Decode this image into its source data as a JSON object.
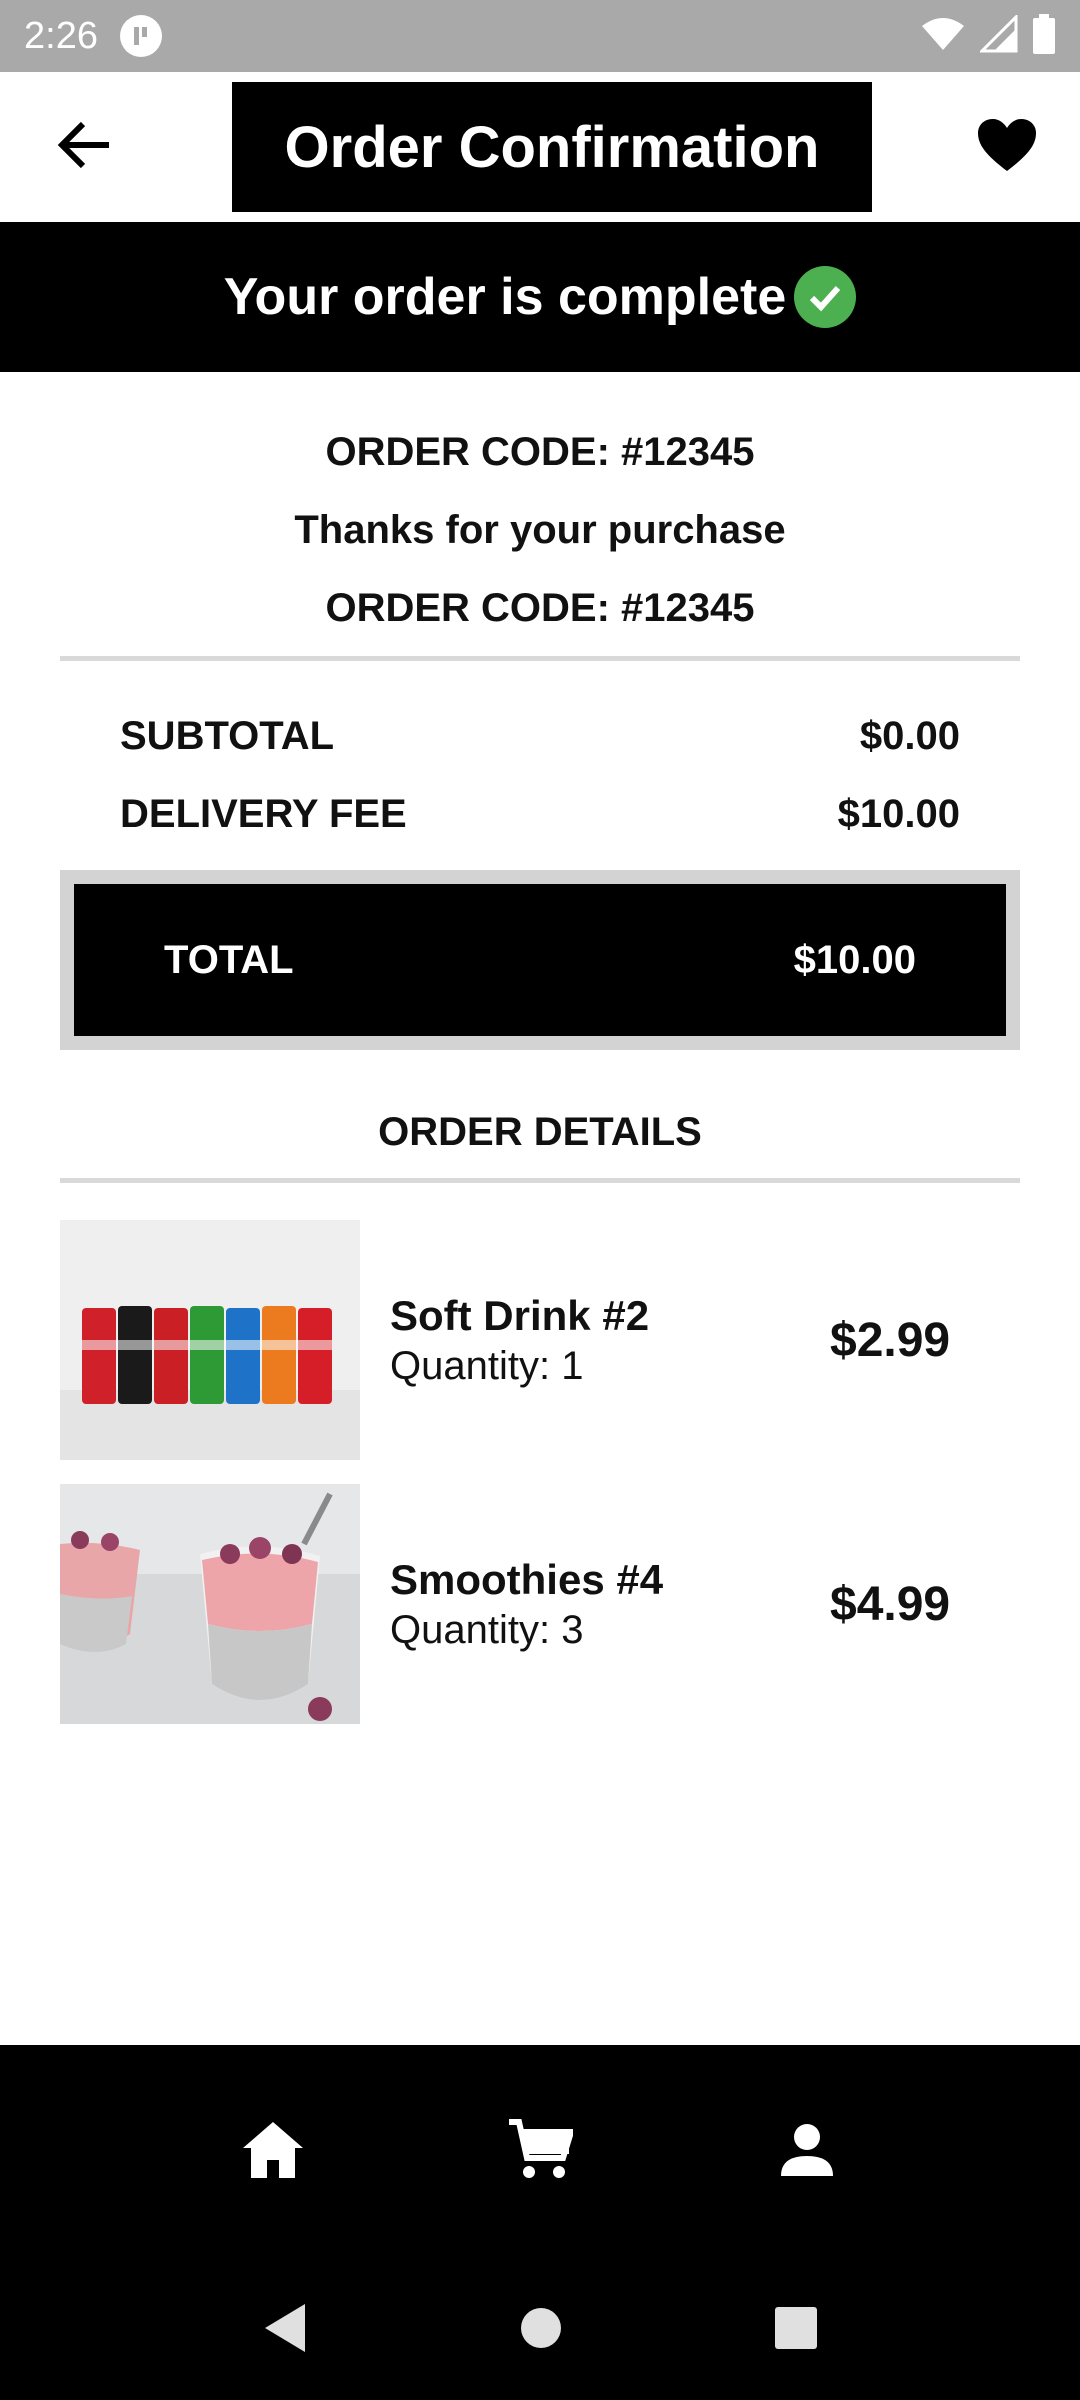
{
  "status_bar": {
    "time": "2:26"
  },
  "header": {
    "title": "Order Confirmation",
    "back_icon": "arrow-left-icon",
    "favorite_icon": "heart-icon"
  },
  "banner": {
    "text": "Your order is complete",
    "icon": "check-circle-icon",
    "icon_color": "#4caf50"
  },
  "order": {
    "code_line_1": "ORDER CODE: #12345",
    "thanks": "Thanks for your purchase",
    "code_line_2": "ORDER CODE: #12345"
  },
  "summary": {
    "subtotal_label": "SUBTOTAL",
    "subtotal_value": "$0.00",
    "delivery_label": "DELIVERY FEE",
    "delivery_value": "$10.00",
    "total_label": "TOTAL",
    "total_value": "$10.00"
  },
  "details": {
    "heading": "ORDER DETAILS",
    "items": [
      {
        "name": "Soft Drink #2",
        "quantity": "Quantity: 1",
        "price": "$2.99"
      },
      {
        "name": "Smoothies #4",
        "quantity": "Quantity: 3",
        "price": "$4.99"
      }
    ]
  },
  "bottom_nav": {
    "items": [
      "home-icon",
      "cart-icon",
      "person-icon"
    ]
  },
  "system_nav": {
    "items": [
      "back-triangle-icon",
      "home-circle-icon",
      "recents-square-icon"
    ]
  }
}
